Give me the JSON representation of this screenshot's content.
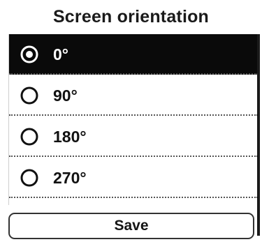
{
  "header": {
    "title": "Screen orientation"
  },
  "orientation_options": [
    {
      "label": "0°",
      "selected": true
    },
    {
      "label": "90°",
      "selected": false
    },
    {
      "label": "180°",
      "selected": false
    },
    {
      "label": "270°",
      "selected": false
    }
  ],
  "footer": {
    "save_label": "Save"
  },
  "colors": {
    "selected_background": "#0a0a0a",
    "selected_text": "#ffffff",
    "text": "#111111",
    "background": "#ffffff"
  },
  "icons": {
    "radio_selected": "radio-selected-icon",
    "radio_unselected": "radio-unselected-icon"
  }
}
